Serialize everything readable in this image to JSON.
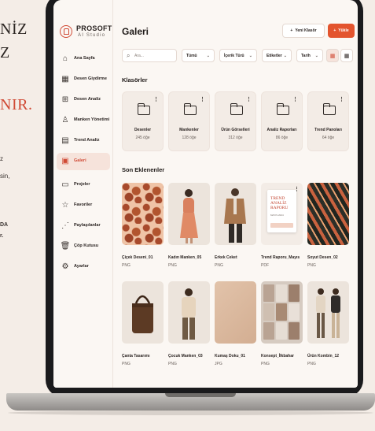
{
  "backdrop": {
    "headline_1": "NİZ",
    "headline_2": "Z",
    "headline_red": "NIR.",
    "body_1": "z",
    "body_2": "sin,",
    "bold_1": "DA",
    "bold_2": "r."
  },
  "brand": {
    "name": "PROSOFT",
    "tagline": "AI Studio",
    "accent": "#d04a35"
  },
  "sidebar": {
    "items": [
      {
        "label": "Ana Sayfa",
        "icon": "home-icon",
        "glyph": "⌂"
      },
      {
        "label": "Desen Giydirme",
        "icon": "grid-icon",
        "glyph": "▦"
      },
      {
        "label": "Desen Analiz",
        "icon": "analysis-icon",
        "glyph": "⊞"
      },
      {
        "label": "Manken Yönetimi",
        "icon": "person-icon",
        "glyph": "♙"
      },
      {
        "label": "Trend Analiz",
        "icon": "trend-icon",
        "glyph": "▤"
      },
      {
        "label": "Galeri",
        "icon": "gallery-icon",
        "glyph": "▣",
        "active": true
      },
      {
        "label": "Projeler",
        "icon": "folder-icon",
        "glyph": "▭"
      },
      {
        "label": "Favoriler",
        "icon": "star-icon",
        "glyph": "☆"
      },
      {
        "label": "Paylaşılanlar",
        "icon": "share-icon",
        "glyph": "⋰"
      },
      {
        "label": "Çöp Kutusu",
        "icon": "trash-icon",
        "glyph": "🗑"
      },
      {
        "label": "Ayarlar",
        "icon": "gear-icon",
        "glyph": "⚙"
      }
    ]
  },
  "header": {
    "title": "Galeri",
    "new_folder_label": "Yeni Klasör",
    "upload_label": "Yükle"
  },
  "filters": {
    "search_placeholder": "Ara...",
    "all_label": "Tümü",
    "content_type_label": "İçerik Türü",
    "tags_label": "Etiketler",
    "date_label": "Tarih"
  },
  "folders_section": {
    "title": "Klasörler",
    "folders": [
      {
        "name": "Desenler",
        "count": "245 öğe"
      },
      {
        "name": "Mankenler",
        "count": "128 öğe"
      },
      {
        "name": "Ürün Görselleri",
        "count": "312 öğe"
      },
      {
        "name": "Analiz Raporları",
        "count": "86 öğe"
      },
      {
        "name": "Trend Panoları",
        "count": "64 öğe"
      }
    ]
  },
  "recent_section": {
    "title": "Son Eklenenler",
    "items": [
      {
        "name": "Çiçek Deseni_01",
        "type": "PNG",
        "art": "pattern-a"
      },
      {
        "name": "Kadın Manken_05",
        "type": "PNG",
        "art": "model-bg"
      },
      {
        "name": "Erkek Ceket",
        "type": "PNG",
        "art": "model-bg"
      },
      {
        "name": "Trend Raporu_Mayıs",
        "type": "PDF",
        "art": "report"
      },
      {
        "name": "Soyut Desen_02",
        "type": "PNG",
        "art": "pattern-b"
      },
      {
        "name": "Çanta Tasarımı",
        "type": "PNG",
        "art": "model-bg"
      },
      {
        "name": "Çocuk Manken_03",
        "type": "PNG",
        "art": "model-bg"
      },
      {
        "name": "Kumaş Doku_01",
        "type": "JPG",
        "art": "fabric"
      },
      {
        "name": "Konsept_İlkbahar",
        "type": "PNG",
        "art": "mood"
      },
      {
        "name": "Ürün Kombin_12",
        "type": "PNG",
        "art": "model-bg"
      }
    ],
    "report_cover": {
      "line_1": "TREND",
      "line_2": "ANALİZ",
      "line_3": "RAPORU",
      "line_4": "MAYIS 2024"
    }
  }
}
